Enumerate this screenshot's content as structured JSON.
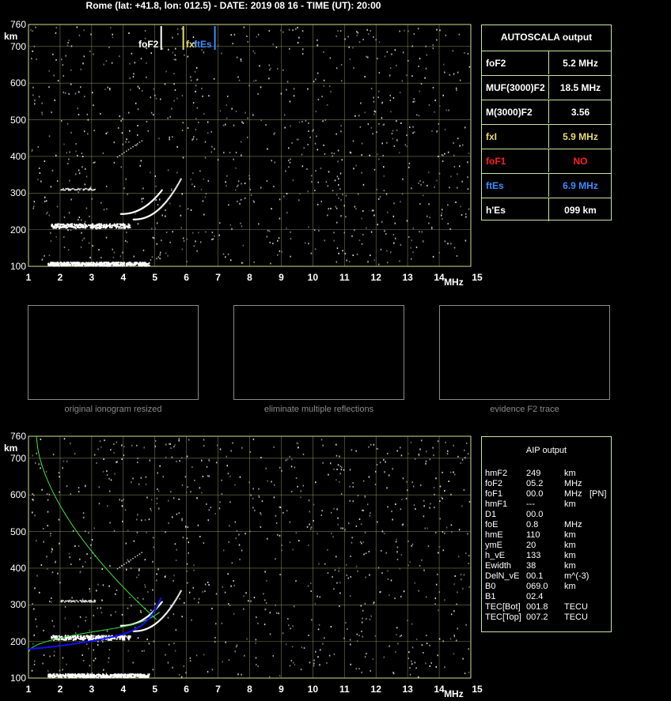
{
  "header": {
    "title": "Rome (lat: +41.8, lon: 012.5) - DATE: 2019 08 16 - TIME (UT): 20:00"
  },
  "axes": {
    "y_labels": [
      "760",
      "700",
      "600",
      "500",
      "400",
      "300",
      "200",
      "100"
    ],
    "y_unit": "km",
    "x_labels": [
      "1",
      "2",
      "3",
      "4",
      "5",
      "6",
      "7",
      "8",
      "9",
      "10",
      "11",
      "12",
      "13",
      "14",
      "15"
    ],
    "x_unit": "MHz"
  },
  "markers": {
    "foF2": "foF2",
    "fxI": "fxI",
    "ftEs": "ftEs"
  },
  "autoscala": {
    "title": "AUTOSCALA output",
    "rows": [
      {
        "key": "foF2",
        "value": "5.2 MHz",
        "color": "#ffffff"
      },
      {
        "key": "MUF(3000)F2",
        "value": "18.5 MHz",
        "color": "#ffffff"
      },
      {
        "key": "M(3000)F2",
        "value": "3.56",
        "color": "#ffffff"
      },
      {
        "key": "fxI",
        "value": "5.9 MHz",
        "color": "#e6dc6e"
      },
      {
        "key": "foF1",
        "value": "NO",
        "color": "#ff2020"
      },
      {
        "key": "ftEs",
        "value": "6.9 MHz",
        "color": "#3c8cff"
      },
      {
        "key": "h'Es",
        "value": "099     km",
        "color": "#ffffff"
      }
    ]
  },
  "thumbnails": {
    "captions": [
      "original ionogram resized",
      "eliminate multiple reflections",
      "evidence F2 trace"
    ]
  },
  "aip": {
    "title": "AIP output",
    "rows": [
      {
        "name": "hmF2",
        "val": "249",
        "unit": "km",
        "extra": ""
      },
      {
        "name": "foF2",
        "val": "05.2",
        "unit": "MHz",
        "extra": ""
      },
      {
        "name": "foF1",
        "val": "00.0",
        "unit": "MHz",
        "extra": "[PN]"
      },
      {
        "name": "hmF1",
        "val": "---",
        "unit": "km",
        "extra": ""
      },
      {
        "name": "D1",
        "val": "00.0",
        "unit": "",
        "extra": ""
      },
      {
        "name": "foE",
        "val": "0.8",
        "unit": "MHz",
        "extra": ""
      },
      {
        "name": "hmE",
        "val": "110",
        "unit": "km",
        "extra": ""
      },
      {
        "name": "ymE",
        "val": "20",
        "unit": "km",
        "extra": ""
      },
      {
        "name": "h_vE",
        "val": "133",
        "unit": "km",
        "extra": ""
      },
      {
        "name": "Ewidth",
        "val": "38",
        "unit": "km",
        "extra": ""
      },
      {
        "name": "DelN_vE",
        "val": "00.1",
        "unit": "m^(-3)",
        "extra": ""
      },
      {
        "name": "B0",
        "val": "069.0",
        "unit": "km",
        "extra": ""
      },
      {
        "name": "B1",
        "val": "02.4",
        "unit": "",
        "extra": ""
      },
      {
        "name": "TEC[Bot]",
        "val": "001.8",
        "unit": "TECU",
        "extra": ""
      },
      {
        "name": "TEC[Top]",
        "val": "007.2",
        "unit": "TECU",
        "extra": ""
      }
    ]
  },
  "colors": {
    "grid": "#d2dc8c",
    "border": "#c8e6a0",
    "fxI": "#e6dc6e",
    "ftEs": "#3c8cff",
    "nhprofile": "#1010ff",
    "model": "#40e040"
  }
}
